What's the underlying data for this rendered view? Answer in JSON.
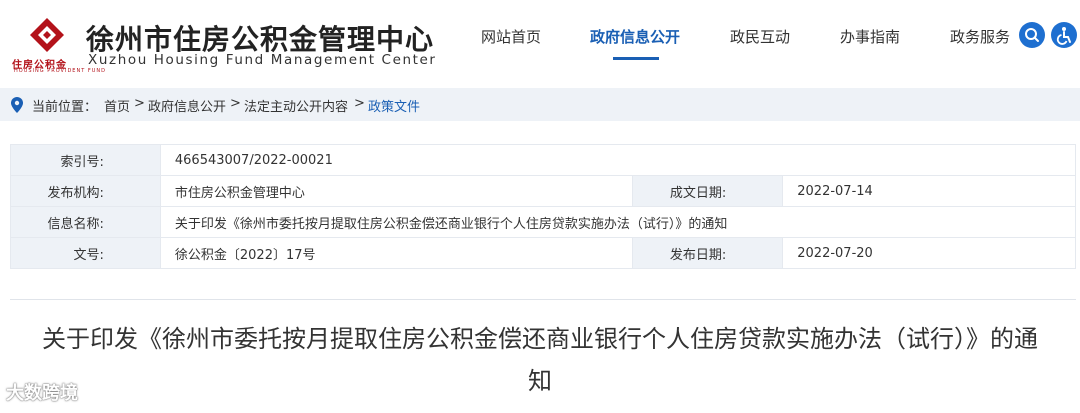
{
  "header": {
    "logo_cn": "徐州市住房公积金管理中心",
    "logo_en": "Xuzhou Housing Fund Management Center",
    "logo_small": "住房公积金",
    "logo_tiny": "HOUSING PROVIDENT FUND",
    "nav": [
      {
        "label": "网站首页",
        "active": false
      },
      {
        "label": "政府信息公开",
        "active": true
      },
      {
        "label": "政民互动",
        "active": false
      },
      {
        "label": "办事指南",
        "active": false
      },
      {
        "label": "政务服务",
        "active": false
      }
    ],
    "accent": "#1a5fb4",
    "brand": "#b3121a"
  },
  "breadcrumb": {
    "prefix": "当前位置：",
    "items": [
      "首页",
      "政府信息公开",
      "法定主动公开内容",
      "政策文件"
    ],
    "sep": ">"
  },
  "info": {
    "index_label": "索引号:",
    "index_value": "466543007/2022-00021",
    "org_label": "发布机构:",
    "org_value": "市住房公积金管理中心",
    "created_label": "成文日期:",
    "created_value": "2022-07-14",
    "name_label": "信息名称:",
    "name_value": "关于印发《徐州市委托按月提取住房公积金偿还商业银行个人住房贷款实施办法（试行）》的通知",
    "docno_label": "文号:",
    "docno_value": "徐公积金〔2022〕17号",
    "published_label": "发布日期:",
    "published_value": "2022-07-20"
  },
  "article": {
    "title": "关于印发《徐州市委托按月提取住房公积金偿还商业银行个人住房贷款实施办法（试行）》的通知"
  },
  "watermark": "大数跨境"
}
